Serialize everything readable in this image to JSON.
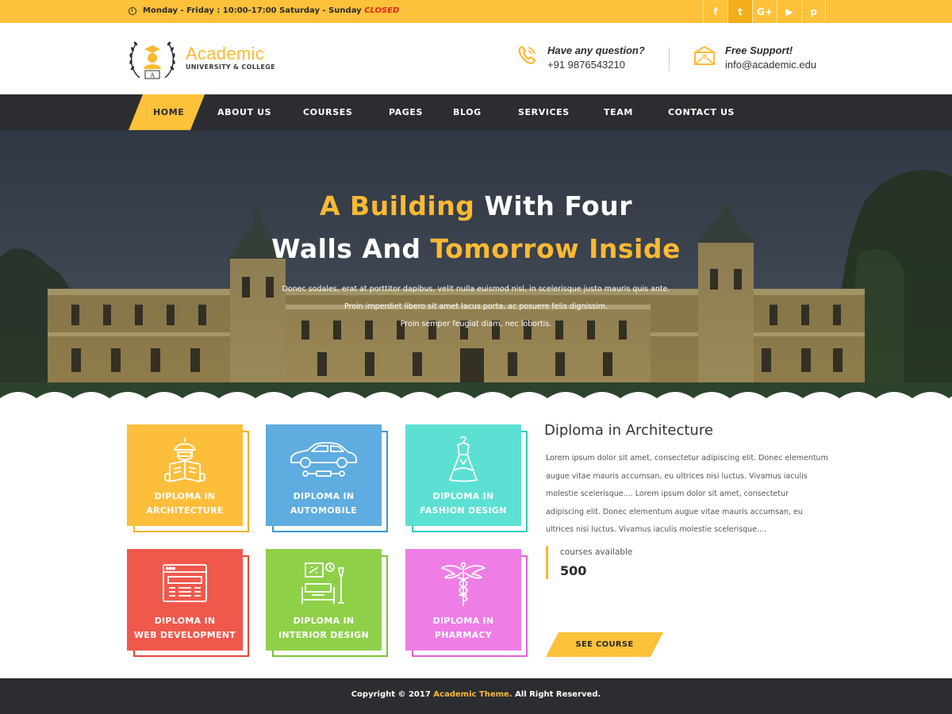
{
  "topbar": {
    "hours_label": "Monday - Friday : 10:00-17:00  Saturday - Sunday",
    "closed_label": "CLOSED",
    "social": [
      {
        "icon": "facebook-icon",
        "glyph": "f"
      },
      {
        "icon": "twitter-icon",
        "glyph": "t"
      },
      {
        "icon": "google-plus-icon",
        "glyph": "G+"
      },
      {
        "icon": "youtube-icon",
        "glyph": "▶"
      },
      {
        "icon": "pinterest-icon",
        "glyph": "p"
      }
    ]
  },
  "header": {
    "brand_name": "Academic",
    "brand_sub": "UNIVERSITY & COLLEGE",
    "phone_title": "Have any question?",
    "phone_value": "+91 9876543210",
    "support_title": "Free Support!",
    "support_value": "info@academic.edu"
  },
  "nav": {
    "items": [
      "HOME",
      "ABOUT US",
      "COURSES",
      "PAGES",
      "BLOG",
      "SERVICES",
      "TEAM",
      "CONTACT US"
    ],
    "active": "HOME"
  },
  "hero": {
    "line1_accent": "A Building",
    "line1_rest": " With Four",
    "line2_lead": "Walls And ",
    "line2_accent": "Tomorrow Inside",
    "para1": "Donec sodales, erat at porttitor dapibus, velit nulla euismod nisl, in scelerisque justo mauris quis ante.",
    "para2": "Proin imperdiet libero sit amet lacus porta, ac posuere felis dignissim.",
    "para3": "Proin semper feugiat diam, nec lobortis."
  },
  "courses": [
    {
      "line1": "DIPLOMA IN",
      "line2": "ARCHITECTURE",
      "color": "#fdbe3c",
      "frame": "#f3b123",
      "icon": "architect-icon"
    },
    {
      "line1": "DIPLOMA IN",
      "line2": "AUTOMOBILE",
      "color": "#5eace0",
      "frame": "#3c97d6",
      "icon": "car-icon"
    },
    {
      "line1": "DIPLOMA IN",
      "line2": "FASHION DESIGN",
      "color": "#5de0d4",
      "frame": "#2ccfc0",
      "icon": "dress-icon"
    },
    {
      "line1": "DIPLOMA IN",
      "line2": "WEB DEVELOPMENT",
      "color": "#f0584c",
      "frame": "#e8453a",
      "icon": "browser-icon"
    },
    {
      "line1": "DIPLOMA IN",
      "line2": "INTERIOR DESIGN",
      "color": "#8fd049",
      "frame": "#7dc437",
      "icon": "interior-icon"
    },
    {
      "line1": "DIPLOMA IN",
      "line2": "PHARMACY",
      "color": "#ee7de6",
      "frame": "#e45fd9",
      "icon": "caduceus-icon"
    }
  ],
  "detail": {
    "title": "Diploma in Architecture",
    "text": "Lorem ipsum dolor sit amet, consectetur adipiscing elit. Donec elementum augue vitae mauris accumsan, eu ultrices nisi luctus. Vivamus iaculis molestie scelerisque.... Lorem ipsum dolor sit amet, consectetur adipiscing elit. Donec elementum augue vitae mauris accumsan, eu ultrices nisi luctus. Vivamus iaculis molestie scelerisque....",
    "avail_label": "courses available",
    "avail_count": "500",
    "button": "SEE COURSE"
  },
  "footer": {
    "pre": "Copyright © 2017 ",
    "accent": "Academic Theme.",
    "post": " All Right Reserved."
  },
  "colors": {
    "accent": "#fdc13a",
    "dark": "#2b2d30",
    "closed": "#e0261b"
  }
}
